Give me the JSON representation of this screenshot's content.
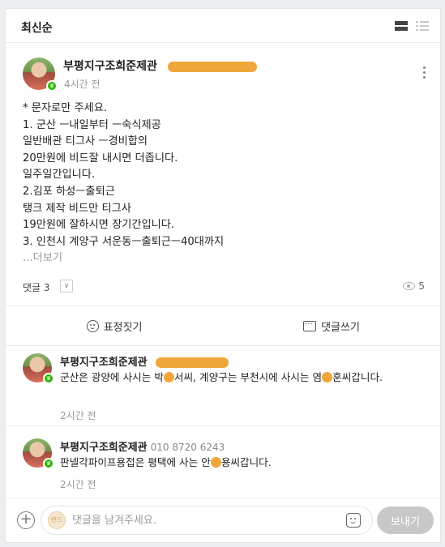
{
  "header": {
    "sort_label": "최신순"
  },
  "post": {
    "author": "부평지구조희준제관",
    "time": "4시간 전",
    "lines": [
      "* 문자로만 주세요.",
      "1. 군산 ㅡ내일부터 ㅡ숙식제공",
      "일반배관 티그사 ㅡ경비합의",
      "20만원에 비드잘 내시면 더좁니다.",
      "일주일간입니다.",
      "2.김포 하성ㅡ출퇴근",
      "탱크 제작 비드만 티그사",
      "19만원에 잘하시면 장기간입니다.",
      "3. 인천시 계양구 서운동ㅡ출퇴근ㅡ40대까지"
    ],
    "more_label": "...더보기",
    "comment_count_label": "댓글 3",
    "views": "5"
  },
  "actions": {
    "react_label": "표정짓기",
    "comment_label": "댓글쓰기"
  },
  "comments": [
    {
      "author": "부평지구조희준제관",
      "text_a": "군산은 광양에 사시는 박",
      "text_b": "서씨, 계양구는 부천시에 사시는 염",
      "text_c": "훈씨갑니다.",
      "time": "2시간 전"
    },
    {
      "author": "부평지구조희준제관",
      "phone": "010 8720 6243",
      "text_a": "판넬각파이프용접은 평택에 사는 안",
      "text_b": "용씨갑니다.",
      "time": "2시간 전"
    }
  ],
  "compose": {
    "placeholder": "댓글을 남겨주세요.",
    "send_label": "보내기"
  },
  "colors": {
    "redaction": "#efa73b",
    "badge": "#2db400"
  }
}
